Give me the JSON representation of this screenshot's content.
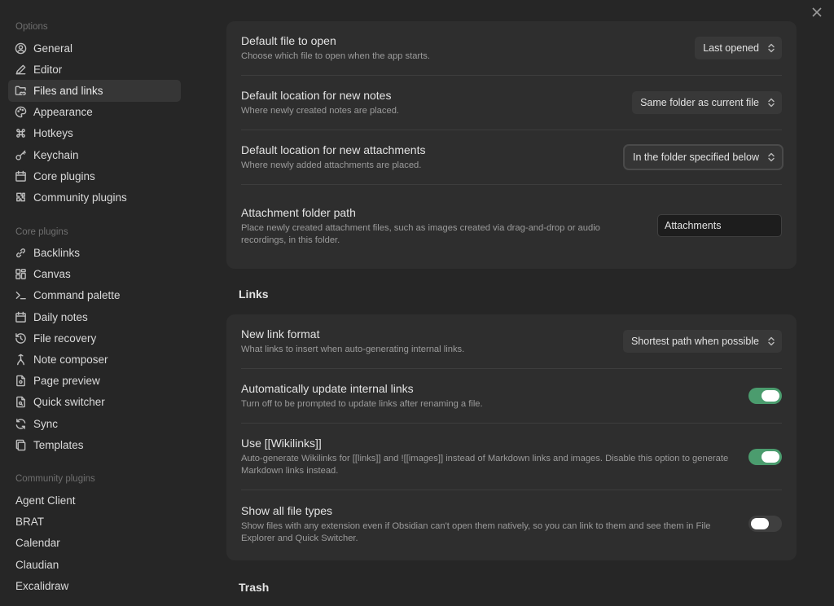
{
  "sidebar": {
    "options": {
      "title": "Options",
      "items": [
        {
          "label": "General"
        },
        {
          "label": "Editor"
        },
        {
          "label": "Files and links"
        },
        {
          "label": "Appearance"
        },
        {
          "label": "Hotkeys"
        },
        {
          "label": "Keychain"
        },
        {
          "label": "Core plugins"
        },
        {
          "label": "Community plugins"
        }
      ]
    },
    "core_plugins": {
      "title": "Core plugins",
      "items": [
        {
          "label": "Backlinks"
        },
        {
          "label": "Canvas"
        },
        {
          "label": "Command palette"
        },
        {
          "label": "Daily notes"
        },
        {
          "label": "File recovery"
        },
        {
          "label": "Note composer"
        },
        {
          "label": "Page preview"
        },
        {
          "label": "Quick switcher"
        },
        {
          "label": "Sync"
        },
        {
          "label": "Templates"
        }
      ]
    },
    "community_plugins": {
      "title": "Community plugins",
      "items": [
        {
          "label": "Agent Client"
        },
        {
          "label": "BRAT"
        },
        {
          "label": "Calendar"
        },
        {
          "label": "Claudian"
        },
        {
          "label": "Excalidraw"
        }
      ]
    }
  },
  "files": {
    "default_file": {
      "name": "Default file to open",
      "desc": "Choose which file to open when the app starts.",
      "value": "Last opened"
    },
    "new_notes_location": {
      "name": "Default location for new notes",
      "desc": "Where newly created notes are placed.",
      "value": "Same folder as current file"
    },
    "attachments_location": {
      "name": "Default location for new attachments",
      "desc": "Where newly added attachments are placed.",
      "value": "In the folder specified below"
    },
    "attachment_folder": {
      "name": "Attachment folder path",
      "desc": "Place newly created attachment files, such as images created via drag-and-drop or audio recordings, in this folder.",
      "value": "Attachments"
    }
  },
  "links": {
    "heading": "Links",
    "new_link_format": {
      "name": "New link format",
      "desc": "What links to insert when auto-generating internal links.",
      "value": "Shortest path when possible"
    },
    "auto_update": {
      "name": "Automatically update internal links",
      "desc": "Turn off to be prompted to update links after renaming a file.",
      "enabled": true
    },
    "wikilinks": {
      "name": "Use [[Wikilinks]]",
      "desc": "Auto-generate Wikilinks for [[links]] and ![[images]] instead of Markdown links and images. Disable this option to generate Markdown links instead.",
      "enabled": true
    },
    "show_all_types": {
      "name": "Show all file types",
      "desc": "Show files with any extension even if Obsidian can't open them natively, so you can link to them and see them in File Explorer and Quick Switcher.",
      "enabled": false
    }
  },
  "trash": {
    "heading": "Trash"
  },
  "colors": {
    "toggle_on": "#4b9c6e",
    "background": "#262626",
    "card": "#2e2e2e"
  },
  "icons": [
    "user-circle-icon",
    "pencil-icon",
    "folder-link-icon",
    "palette-icon",
    "command-icon",
    "key-icon",
    "calendar-icon",
    "community-icon",
    "backlinks-icon",
    "canvas-icon",
    "terminal-icon",
    "daily-calendar-icon",
    "history-icon",
    "merge-icon",
    "preview-icon",
    "file-search-icon",
    "sync-icon",
    "templates-icon",
    "close-icon",
    "chevron-updown-icon"
  ]
}
